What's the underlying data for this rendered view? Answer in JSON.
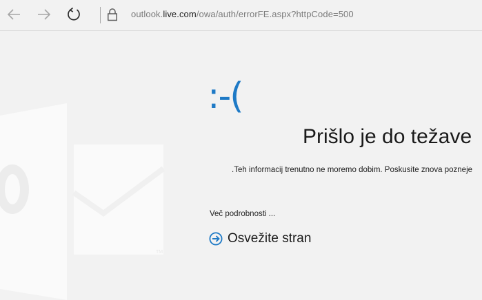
{
  "browser": {
    "back_icon": "arrow-left-icon",
    "forward_icon": "arrow-right-icon",
    "refresh_icon": "refresh-icon",
    "lock_icon": "lock-icon",
    "url_prefix": "outlook.",
    "url_host": "live.com",
    "url_path": "/owa/auth/errorFE.aspx?httpCode=500"
  },
  "error": {
    "face": ":-(",
    "title": "Prišlo je do težave",
    "message": ".Teh informacij trenutno ne moremo dobim. Poskusite znova pozneje",
    "details_link": "Več podrobnosti ...",
    "refresh_label": "Osvežite stran",
    "refresh_icon": "arrow-circle-right-icon",
    "accent_color": "#1e7ac6"
  },
  "background": {
    "logo": "outlook-logo-watermark"
  }
}
